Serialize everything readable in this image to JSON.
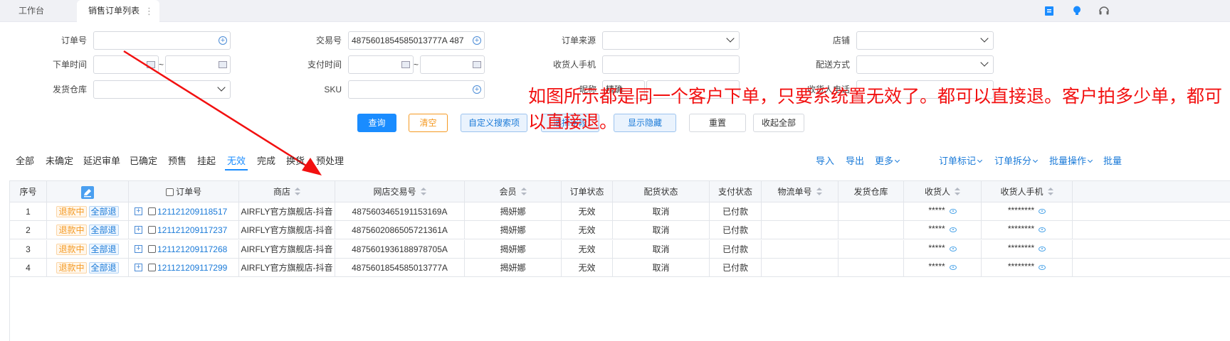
{
  "tabs": {
    "home": "工作台",
    "active": "销售订单列表",
    "more": "⋮"
  },
  "form": {
    "order_no_label": "订单号",
    "trade_no_label": "交易号",
    "trade_no_value": "4875601854585013777A 487",
    "order_source_label": "订单来源",
    "shop_label": "店铺",
    "order_time_label": "下单时间",
    "pay_time_label": "支付时间",
    "receiver_phone_label": "收货人手机",
    "delivery_method_label": "配送方式",
    "ship_warehouse_label": "发货仓库",
    "sku_label": "SKU",
    "nickname_label": "昵称",
    "nickname_value": "精确",
    "receiver_phone2_label": "收货人电话",
    "range_sep": "~"
  },
  "buttons": {
    "query": "查询",
    "clear": "清空",
    "custom_search": "自定义搜索项",
    "hidden_btn_1": "选择字段",
    "hidden_btn_2": "显示隐藏",
    "hidden_btn_3": "重置",
    "collapse_all": "收起全部"
  },
  "annotation": "如图所示都是同一个客户下单，只要系统置无效了。都可以直接退。客户拍多少单，都可以直接退。",
  "status_tabs": [
    "全部",
    "未确定",
    "延迟审单",
    "已确定",
    "预售",
    "挂起",
    "无效",
    "完成",
    "换货",
    "预处理"
  ],
  "active_status_tab": "无效",
  "right_actions": {
    "import": "导入",
    "export": "导出",
    "more": "更多",
    "order_mark": "订单标记",
    "order_split": "订单拆分",
    "batch_ops": "批量操作",
    "batch_cut": "批量"
  },
  "table": {
    "headers": {
      "seq": "序号",
      "order_no": "订单号",
      "shop": "商店",
      "online_trade_no": "网店交易号",
      "member": "会员",
      "order_status": "订单状态",
      "alloc_status": "配货状态",
      "pay_status": "支付状态",
      "logistics_no": "物流单号",
      "ship_warehouse": "发货仓库",
      "receiver": "收货人",
      "receiver_phone": "收货人手机"
    },
    "rows": [
      {
        "seq": "1",
        "refund_tag": "退款中",
        "refund_type": "全部退",
        "order_no": "121121209118517",
        "shop": "AIRFLY官方旗舰店-抖音",
        "trade_no": "4875603465191153169A",
        "member": "揭妍娜",
        "order_status": "无效",
        "alloc_status": "取消",
        "pay_status": "已付款",
        "receiver": "*****",
        "phone": "********"
      },
      {
        "seq": "2",
        "refund_tag": "退款中",
        "refund_type": "全部退",
        "order_no": "121121209117237",
        "shop": "AIRFLY官方旗舰店-抖音",
        "trade_no": "4875602086505721361A",
        "member": "揭妍娜",
        "order_status": "无效",
        "alloc_status": "取消",
        "pay_status": "已付款",
        "receiver": "*****",
        "phone": "********"
      },
      {
        "seq": "3",
        "refund_tag": "退款中",
        "refund_type": "全部退",
        "order_no": "121121209117268",
        "shop": "AIRFLY官方旗舰店-抖音",
        "trade_no": "4875601936188978705A",
        "member": "揭妍娜",
        "order_status": "无效",
        "alloc_status": "取消",
        "pay_status": "已付款",
        "receiver": "*****",
        "phone": "********"
      },
      {
        "seq": "4",
        "refund_tag": "退款中",
        "refund_type": "全部退",
        "order_no": "121121209117299",
        "shop": "AIRFLY官方旗舰店-抖音",
        "trade_no": "4875601854585013777A",
        "member": "揭妍娜",
        "order_status": "无效",
        "alloc_status": "取消",
        "pay_status": "已付款",
        "receiver": "*****",
        "phone": "********"
      }
    ]
  }
}
